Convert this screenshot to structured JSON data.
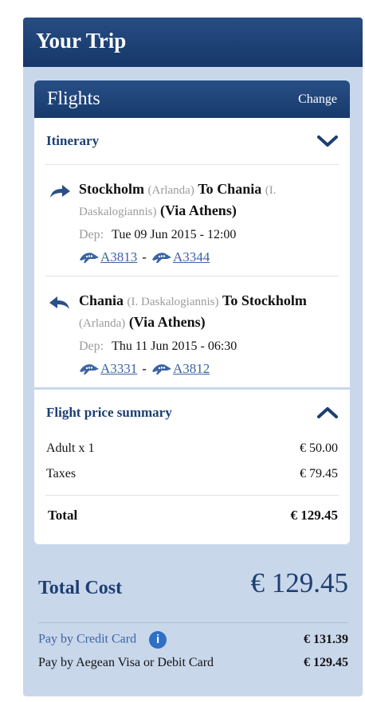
{
  "panel": {
    "title": "Your Trip"
  },
  "flights": {
    "title": "Flights",
    "change_label": "Change",
    "itinerary_label": "Itinerary",
    "outbound": {
      "from_city": "Stockholm",
      "from_airport": "(Arlanda)",
      "to_word": "To",
      "to_city": "Chania",
      "to_airport": "(I. Daskalogiannis)",
      "via": "(Via Athens)",
      "dep_label": "Dep:",
      "dep_value": "Tue 09 Jun 2015 - 12:00",
      "flight1": "A3813",
      "separator": "-",
      "flight2": "A3344"
    },
    "inbound": {
      "from_city": "Chania",
      "from_airport": "(I. Daskalogiannis)",
      "to_word": "To",
      "to_city": "Stockholm",
      "to_airport": "(Arlanda)",
      "via": "(Via Athens)",
      "dep_label": "Dep:",
      "dep_value": "Thu 11 Jun 2015 - 06:30",
      "flight1": "A3331",
      "separator": "-",
      "flight2": "A3812"
    }
  },
  "summary": {
    "title": "Flight price summary",
    "rows": [
      {
        "label": "Adult x 1",
        "value": "€ 50.00"
      },
      {
        "label": "Taxes",
        "value": "€ 79.45"
      }
    ],
    "total_label": "Total",
    "total_value": "€ 129.45"
  },
  "total_cost": {
    "label": "Total Cost",
    "value": "€ 129.45"
  },
  "payment": {
    "credit_label": "Pay by Credit Card",
    "credit_value": "€ 131.39",
    "info_glyph": "i",
    "debit_label": "Pay by Aegean Visa or Debit Card",
    "debit_value": "€ 129.45"
  },
  "colors": {
    "navy": "#1d3f72",
    "link": "#3b64a3",
    "panel_bg": "#c9d7eb",
    "info": "#2d70c4"
  },
  "icons": [
    "arrow-right-icon",
    "arrow-left-icon",
    "plane-icon",
    "chevron-down-icon",
    "chevron-up-icon",
    "info-icon"
  ]
}
